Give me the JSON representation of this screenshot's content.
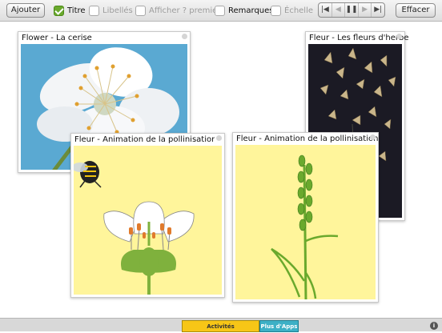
{
  "toolbar": {
    "add_label": "Ajouter",
    "clear_label": "Effacer",
    "toggles": [
      {
        "label": "Titre",
        "checked": true
      },
      {
        "label": "Libellés",
        "checked": false
      },
      {
        "label": "Afficher ? premier",
        "checked": false
      },
      {
        "label": "Remarques",
        "checked": false
      },
      {
        "label": "Échelle",
        "checked": false
      }
    ],
    "media": {
      "first": "|◀",
      "prev": "◀",
      "pause": "❚❚",
      "next": "▶",
      "last": "▶|"
    }
  },
  "cards": [
    {
      "title": "Flower - La cerise"
    },
    {
      "title": "Fleur - Les fleurs d'herbe"
    },
    {
      "title": "Fleur - Animation de la pollinisation p"
    },
    {
      "title": "Fleur - Animation de la pollinisation"
    }
  ],
  "bottom": {
    "tab_activities": "Activités",
    "tab_more": "Plus d'Apps",
    "info": "i"
  },
  "colors": {
    "checked": "#6aa92d",
    "activities_tab": "#f7c617",
    "more_tab": "#3db0c6",
    "animation_bg": "#fff59b",
    "sky": "#5aa9d2"
  }
}
